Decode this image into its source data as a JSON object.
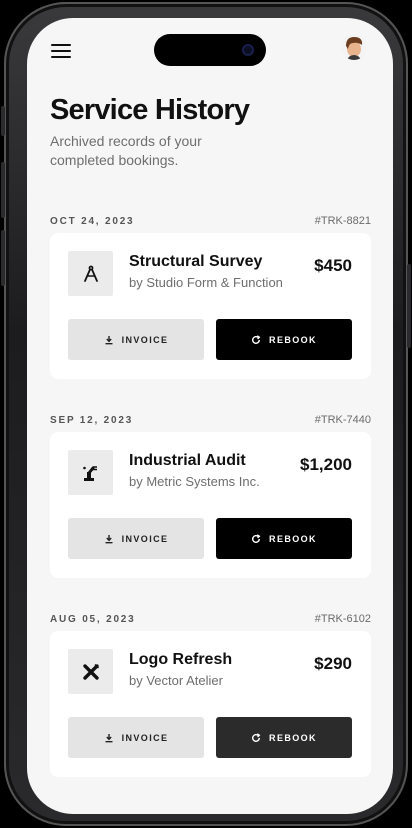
{
  "header": {
    "title": "Service History",
    "subtitle": "Archived records of your completed bookings."
  },
  "bookings": [
    {
      "date": "OCT 24, 2023",
      "ref": "#TRK-8821",
      "service": "Structural Survey",
      "provider": "by Studio Form & Function",
      "price": "$450",
      "icon": "compass-icon",
      "invoice_label": "INVOICE",
      "rebook_label": "REBOOK"
    },
    {
      "date": "SEP 12, 2023",
      "ref": "#TRK-7440",
      "service": "Industrial Audit",
      "provider": "by Metric Systems Inc.",
      "price": "$1,200",
      "icon": "robot-arm-icon",
      "invoice_label": "INVOICE",
      "rebook_label": "REBOOK"
    },
    {
      "date": "AUG 05, 2023",
      "ref": "#TRK-6102",
      "service": "Logo Refresh",
      "provider": "by Vector Atelier",
      "price": "$290",
      "icon": "design-tools-icon",
      "invoice_label": "INVOICE",
      "rebook_label": "REBOOK"
    }
  ],
  "icons": {
    "menu": "hamburger-menu-icon",
    "avatar": "user-avatar",
    "invoice": "download-icon",
    "rebook": "refresh-icon"
  },
  "colors": {
    "screen_background": "#f6f6f6",
    "card_background": "#ffffff",
    "primary_button": "#000000",
    "secondary_button": "#e4e4e4"
  }
}
